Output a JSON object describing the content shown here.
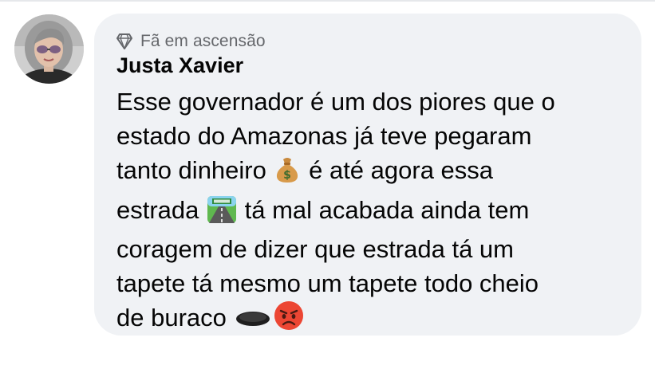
{
  "comment": {
    "badge_label": "Fã em ascensão",
    "author_name": "Justa Xavier",
    "text_lines": [
      "Esse governador é um dos piores que o",
      "estado do Amazonas já teve pegaram",
      [
        "tanto dinheiro ",
        "money-bag-emoji",
        " é até agora essa"
      ],
      [
        "estrada ",
        "motorway-emoji",
        " tá mal acabada ainda tem"
      ],
      "coragem de dizer que estrada tá um",
      "tapete tá mesmo um tapete todo cheio",
      [
        "de buraco ",
        "hole-emoji",
        "angry-face-emoji"
      ]
    ]
  },
  "text": {
    "line1": "Esse governador é um dos piores que o",
    "line2": "estado do Amazonas já teve pegaram",
    "line3a": "tanto dinheiro ",
    "line3b": " é até agora essa",
    "line4a": "estrada ",
    "line4b": " tá mal acabada ainda tem",
    "line5": "coragem de dizer que estrada tá um",
    "line6": "tapete tá mesmo um tapete todo cheio",
    "line7a": "de buraco "
  },
  "icons": {
    "badge": "diamond-icon",
    "avatar": "avatar"
  },
  "colors": {
    "bubble": "#f0f2f5",
    "badge_text": "#65676b",
    "text": "#050505"
  }
}
